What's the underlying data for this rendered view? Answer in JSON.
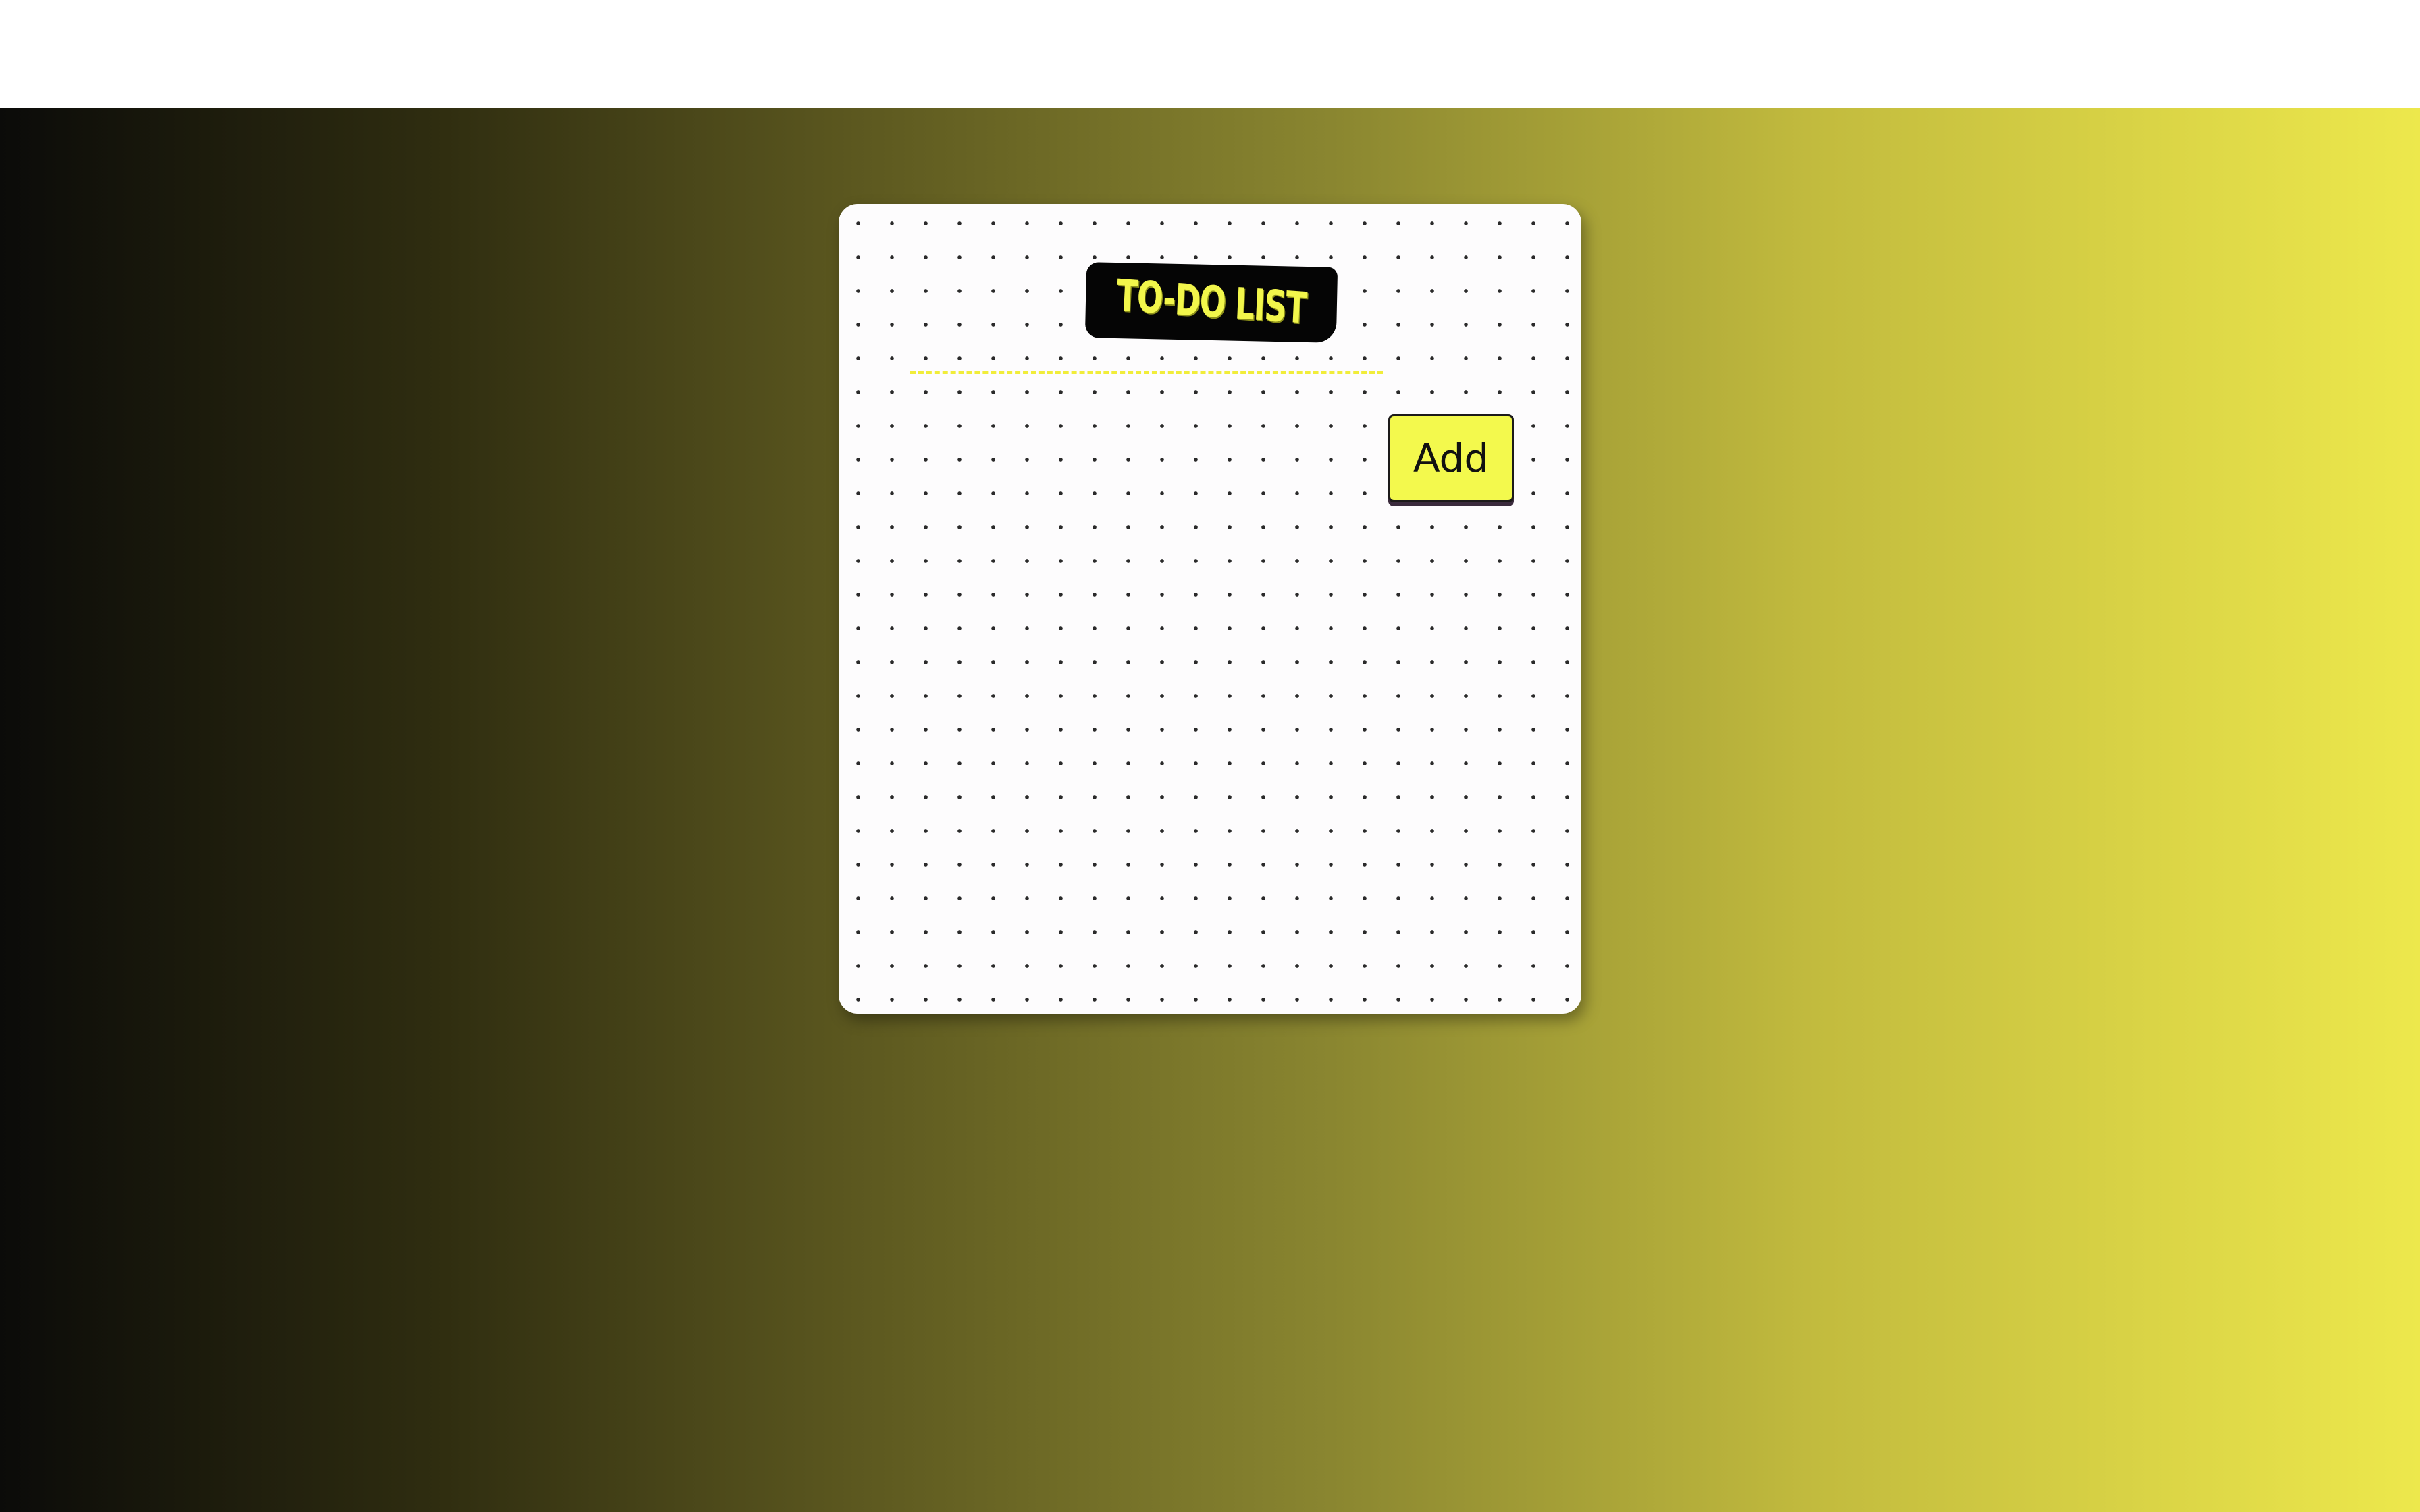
{
  "app": {
    "title": "TO-DO LIST"
  },
  "task_input": {
    "value": "",
    "placeholder": ""
  },
  "add_button": {
    "label": "Add"
  },
  "colors": {
    "accent": "#f3f94d",
    "title_text": "#f2f64b",
    "title_background": "#050505",
    "gradient_start": "#0b0b09",
    "gradient_end": "#ede84c",
    "card_background": "#fdfcfd"
  }
}
